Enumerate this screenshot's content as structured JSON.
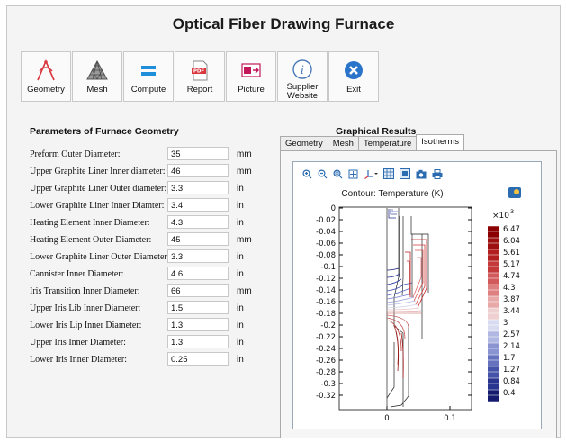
{
  "app": {
    "title": "Optical Fiber Drawing Furnace"
  },
  "toolbar": [
    {
      "label": "Geometry",
      "icon": "geometry-icon"
    },
    {
      "label": "Mesh",
      "icon": "mesh-icon"
    },
    {
      "label": "Compute",
      "icon": "compute-icon"
    },
    {
      "label": "Report",
      "icon": "pdf-icon"
    },
    {
      "label": "Picture",
      "icon": "picture-icon"
    },
    {
      "label": "Supplier Website",
      "icon": "info-icon"
    },
    {
      "label": "Exit",
      "icon": "close-icon"
    }
  ],
  "params": {
    "heading": "Parameters of Furnace Geometry",
    "rows": [
      {
        "label": "Preform Outer Diameter:",
        "value": "35",
        "unit": "mm"
      },
      {
        "label": "Upper Graphite Liner Inner diameter:",
        "value": "46",
        "unit": "mm"
      },
      {
        "label": "Upper Graphite Liner Outer diameter:",
        "value": "3.3",
        "unit": "in"
      },
      {
        "label": "Lower Graphite Liner Inner Diamter:",
        "value": "3.4",
        "unit": "in"
      },
      {
        "label": "Heating Element Inner Diameter:",
        "value": "4.3",
        "unit": "in"
      },
      {
        "label": "Heating Element Outer Diameter:",
        "value": "45",
        "unit": "mm"
      },
      {
        "label": "Lower Graphite Liner Outer Diameter:",
        "value": "3.3",
        "unit": "in"
      },
      {
        "label": "Cannister Inner Diameter:",
        "value": "4.6",
        "unit": "in"
      },
      {
        "label": "Iris Transition Inner Diameter:",
        "value": "66",
        "unit": "mm"
      },
      {
        "label": "Upper Iris Lib Inner Diameter:",
        "value": "1.5",
        "unit": "in"
      },
      {
        "label": "Lower Iris Lip Inner Diameter:",
        "value": "1.3",
        "unit": "in"
      },
      {
        "label": "Upper Iris Inner Diameter:",
        "value": "1.3",
        "unit": "in"
      },
      {
        "label": "Lower Iris Inner Diameter:",
        "value": "0.25",
        "unit": "in"
      }
    ]
  },
  "results": {
    "heading": "Graphical Results",
    "tabs": [
      "Geometry",
      "Mesh",
      "Temperature",
      "Isotherms"
    ],
    "active_tab": "Isotherms",
    "plot_title": "Contour: Temperature (K)",
    "y_ticks": [
      "0",
      "-0.02",
      "-0.04",
      "-0.06",
      "-0.08",
      "-0.1",
      "-0.12",
      "-0.14",
      "-0.16",
      "-0.18",
      "-0.2",
      "-0.22",
      "-0.24",
      "-0.26",
      "-0.28",
      "-0.3",
      "-0.32"
    ],
    "x_ticks": [
      "0",
      "0.1"
    ],
    "colorbar_multiplier": "×10",
    "colorbar_exponent": "3",
    "colorbar_ticks": [
      "6.47",
      "6.04",
      "5.61",
      "5.17",
      "4.74",
      "4.3",
      "3.87",
      "3.44",
      "3",
      "2.57",
      "2.14",
      "1.7",
      "1.27",
      "0.84",
      "0.4"
    ]
  }
}
